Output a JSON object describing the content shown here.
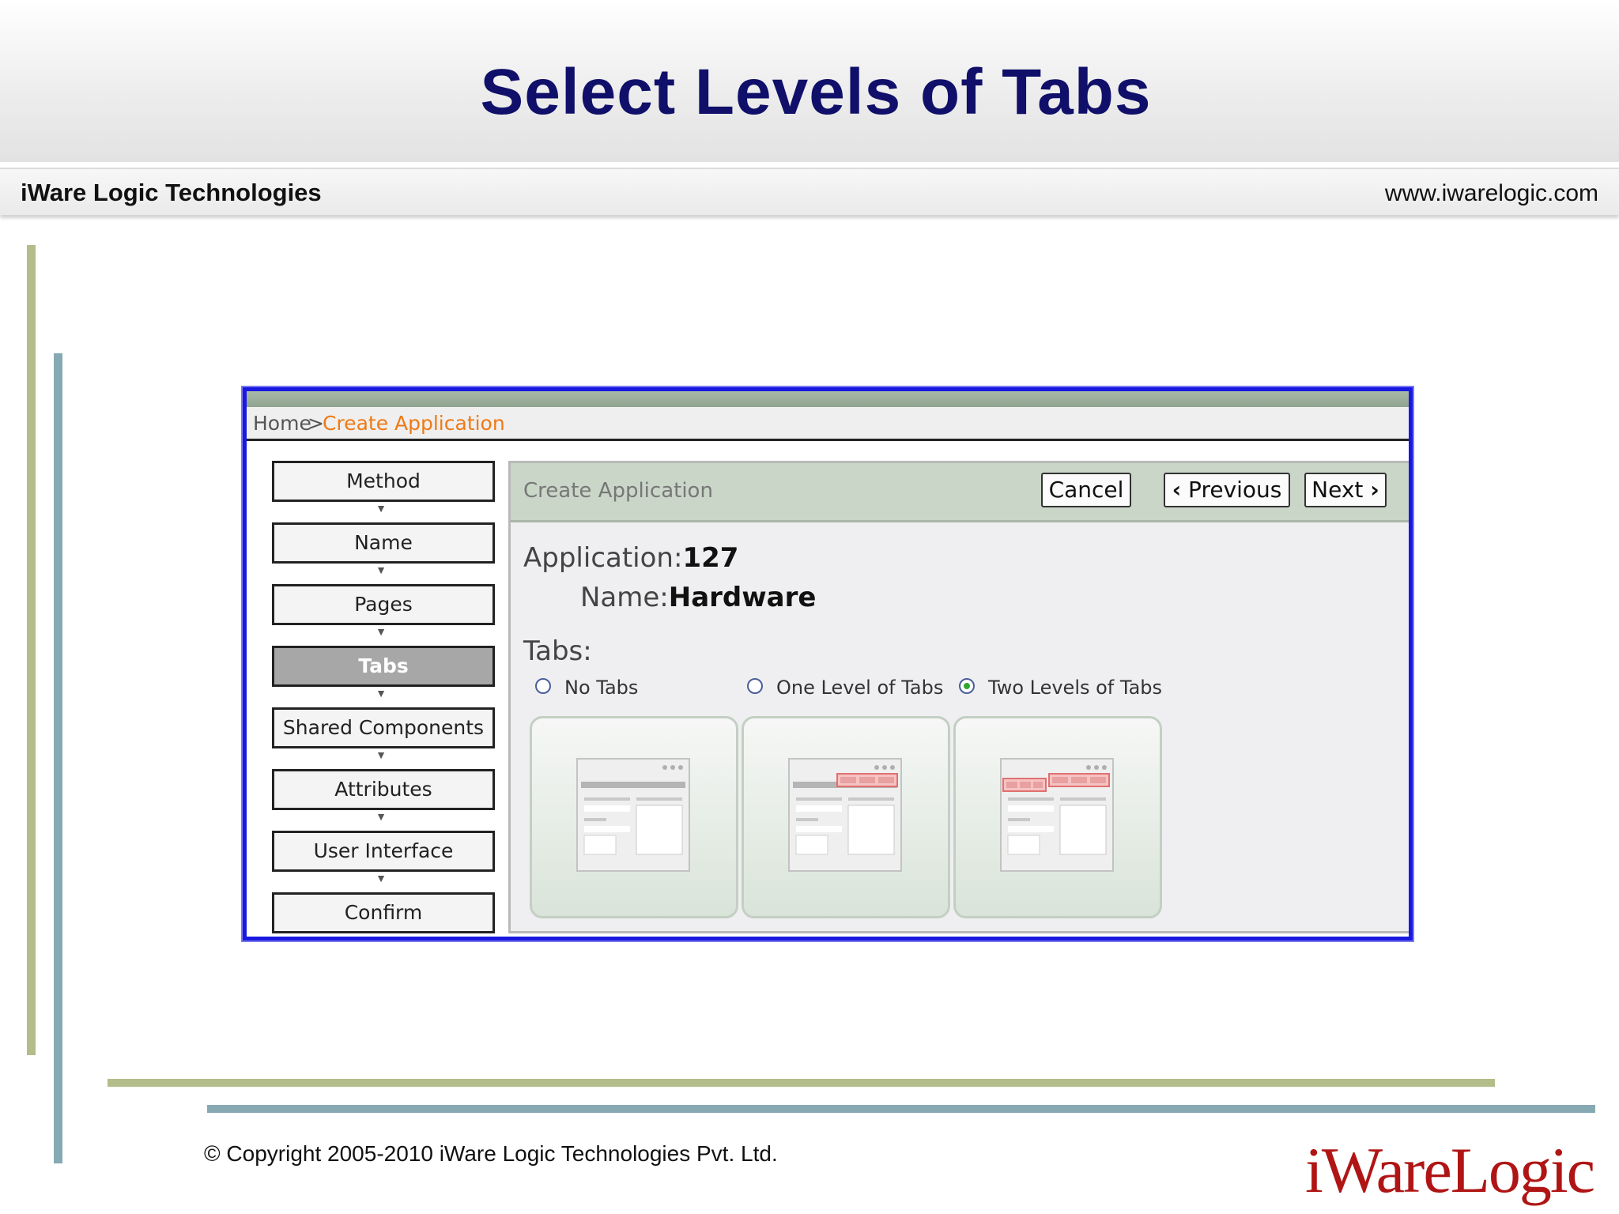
{
  "slide": {
    "title": "Select Levels of Tabs",
    "company": "iWare Logic Technologies",
    "website": "www.iwarelogic.com",
    "copyright": "© Copyright 2005-2010 iWare Logic Technologies Pvt. Ltd.",
    "logo": "iWareLogic"
  },
  "breadcrumb": {
    "home": "Home",
    "separator": ">",
    "current": "Create Application"
  },
  "steps": [
    {
      "label": "Method"
    },
    {
      "label": "Name"
    },
    {
      "label": "Pages"
    },
    {
      "label": "Tabs",
      "current": true
    },
    {
      "label": "Shared Components"
    },
    {
      "label": "Attributes"
    },
    {
      "label": "User Interface"
    },
    {
      "label": "Confirm"
    }
  ],
  "panel": {
    "title": "Create Application",
    "cancel": "Cancel",
    "previous": "Previous",
    "next": "Next"
  },
  "application": {
    "label": "Application:",
    "value": "127",
    "name_label": "Name:",
    "name_value": "Hardware"
  },
  "tabs": {
    "label": "Tabs:",
    "options": [
      {
        "label": "No Tabs",
        "checked": false
      },
      {
        "label": "One Level of Tabs",
        "checked": false
      },
      {
        "label": "Two Levels of Tabs",
        "checked": true
      }
    ]
  },
  "colors": {
    "title": "#10106a",
    "accent_orange": "#ee7a16",
    "frame_blue": "#1818e0",
    "tab_highlight": "#e88a8a"
  }
}
